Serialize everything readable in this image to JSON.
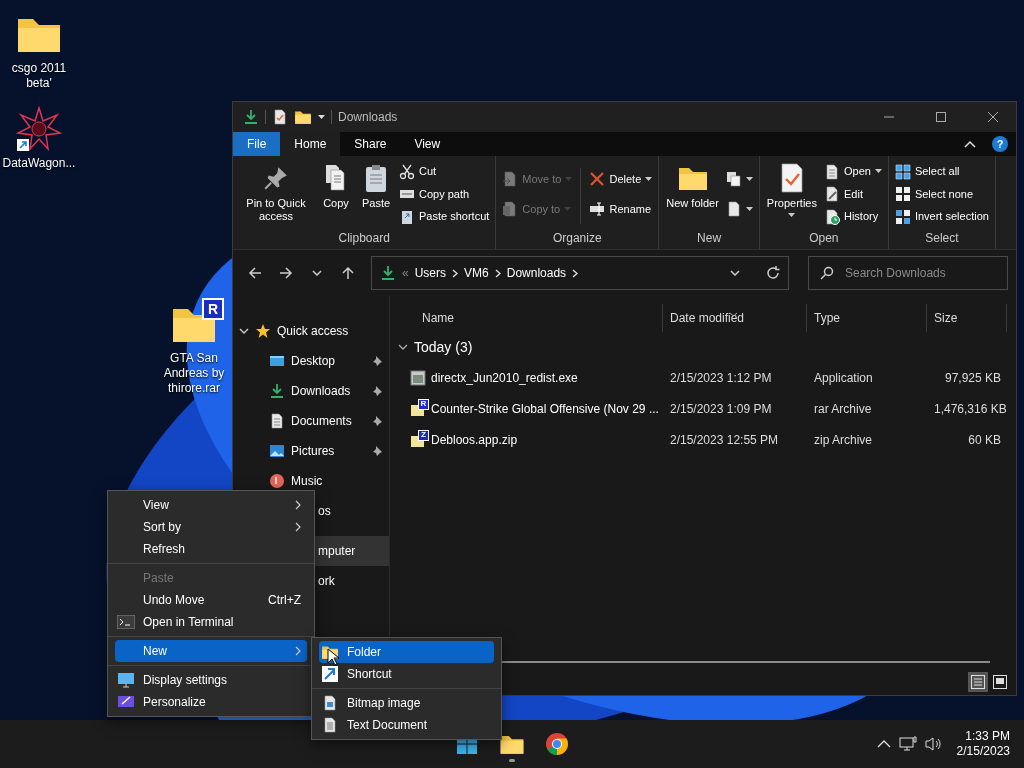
{
  "desktop_icons": [
    {
      "label": "csgo 2011 beta'"
    },
    {
      "label": "DataWagon..."
    },
    {
      "label": "GTA San Andreas by thirore.rar",
      "badge": "R"
    }
  ],
  "explorer": {
    "title": "Downloads",
    "ribbon_tabs": [
      {
        "label": "File",
        "kind": "file",
        "selected": false
      },
      {
        "label": "Home",
        "kind": "tab",
        "selected": true
      },
      {
        "label": "Share",
        "kind": "tab",
        "selected": false
      },
      {
        "label": "View",
        "kind": "tab",
        "selected": false
      }
    ],
    "help_label": "?",
    "ribbon_groups": [
      {
        "label": "Clipboard",
        "columns": [
          {
            "kind": "stack",
            "commands": [
              {
                "label": "Pin to Quick access",
                "kind": "large",
                "dropdown": false,
                "disabled": false
              }
            ]
          },
          {
            "kind": "stack",
            "commands": [
              {
                "label": "Copy",
                "kind": "large",
                "dropdown": false,
                "disabled": false
              }
            ]
          },
          {
            "kind": "stack",
            "commands": [
              {
                "label": "Paste",
                "kind": "large",
                "dropdown": false,
                "disabled": false
              }
            ]
          },
          {
            "kind": "stack",
            "commands": [
              {
                "label": "Cut",
                "kind": "small",
                "dropdown": false,
                "disabled": false
              },
              {
                "label": "Copy path",
                "kind": "small",
                "dropdown": false,
                "disabled": false
              },
              {
                "label": "Paste shortcut",
                "kind": "small",
                "dropdown": false,
                "disabled": false
              }
            ]
          }
        ]
      },
      {
        "label": "Organize",
        "columns": [
          {
            "kind": "stack",
            "commands": [
              {
                "label": "Move to",
                "kind": "small",
                "dropdown": true,
                "disabled": true
              },
              {
                "label": "Copy to",
                "kind": "small",
                "dropdown": true,
                "disabled": true
              }
            ]
          },
          {
            "kind": "separator"
          },
          {
            "kind": "stack",
            "commands": [
              {
                "label": "Delete",
                "kind": "small",
                "dropdown": true,
                "disabled": false
              },
              {
                "label": "Rename",
                "kind": "small",
                "dropdown": false,
                "disabled": false
              }
            ]
          }
        ]
      },
      {
        "label": "New",
        "columns": [
          {
            "kind": "stack",
            "commands": [
              {
                "label": "New folder",
                "kind": "large",
                "dropdown": false,
                "disabled": false
              }
            ]
          },
          {
            "kind": "stack",
            "commands": [
              {
                "kind": "icon",
                "dropdown": true,
                "disabled": false
              },
              {
                "kind": "icon",
                "dropdown": true,
                "disabled": false
              }
            ]
          }
        ]
      },
      {
        "label": "Open",
        "columns": [
          {
            "kind": "stack",
            "commands": [
              {
                "label": "Properties",
                "kind": "large",
                "dropdown": true,
                "disabled": false
              }
            ]
          },
          {
            "kind": "stack",
            "commands": [
              {
                "label": "Open",
                "kind": "small",
                "dropdown": true,
                "disabled": false
              },
              {
                "label": "Edit",
                "kind": "small",
                "dropdown": false,
                "disabled": false
              },
              {
                "label": "History",
                "kind": "small",
                "dropdown": false,
                "disabled": false
              }
            ]
          }
        ]
      },
      {
        "label": "Select",
        "columns": [
          {
            "kind": "stack",
            "commands": [
              {
                "label": "Select all",
                "kind": "small",
                "dropdown": false,
                "disabled": false
              },
              {
                "label": "Select none",
                "kind": "small",
                "dropdown": false,
                "disabled": false
              },
              {
                "label": "Invert selection",
                "kind": "small",
                "dropdown": false,
                "disabled": false
              }
            ]
          }
        ]
      }
    ],
    "address": {
      "overflow": "«",
      "crumbs": [
        "Users",
        "VM6",
        "Downloads"
      ]
    },
    "search": {
      "placeholder": "Search Downloads"
    },
    "sidebar": [
      {
        "label": "Quick access",
        "expanded": true,
        "selected": false,
        "children": [
          {
            "label": "Desktop",
            "pinned": true,
            "selected": false
          },
          {
            "label": "Downloads",
            "pinned": true,
            "selected": false
          },
          {
            "label": "Documents",
            "pinned": true,
            "selected": false
          },
          {
            "label": "Pictures",
            "pinned": true,
            "selected": false
          },
          {
            "label": "Music",
            "pinned": false,
            "selected": false
          },
          {
            "label": "os",
            "pinned": false,
            "selected": false
          }
        ]
      },
      {
        "label": "mputer",
        "selected": true
      },
      {
        "label": "ork",
        "selected": false
      }
    ],
    "columns": [
      {
        "label": "Name",
        "sorted": false
      },
      {
        "label": "Date modified",
        "sorted": true
      },
      {
        "label": "Type",
        "sorted": false
      },
      {
        "label": "Size",
        "sorted": false
      }
    ],
    "group": {
      "label": "Today (3)",
      "expanded": true
    },
    "rows": [
      {
        "name": "directx_Jun2010_redist.exe",
        "date": "2/15/2023 1:12 PM",
        "type": "Application",
        "size": "97,925 KB"
      },
      {
        "name": "Counter-Strike Global Offensive (Nov 29 ...",
        "badge": "R",
        "date": "2/15/2023 1:09 PM",
        "type": "rar Archive",
        "size": "1,476,316 KB"
      },
      {
        "name": "Debloos.app.zip",
        "badge": "Z",
        "date": "2/15/2023 12:55 PM",
        "type": "zip Archive",
        "size": "60 KB"
      }
    ],
    "view_buttons": [
      {
        "selected": true
      },
      {
        "selected": false
      }
    ]
  },
  "context_menu": [
    {
      "label": "View",
      "kind": "item",
      "submenu": true,
      "disabled": false,
      "selected": false
    },
    {
      "label": "Sort by",
      "kind": "item",
      "submenu": true,
      "disabled": false,
      "selected": false
    },
    {
      "label": "Refresh",
      "kind": "item",
      "submenu": false,
      "disabled": false,
      "selected": false
    },
    {
      "kind": "separator"
    },
    {
      "label": "Paste",
      "kind": "item",
      "submenu": false,
      "disabled": true,
      "selected": false
    },
    {
      "label": "Undo Move",
      "kind": "item",
      "shortcut": "Ctrl+Z",
      "submenu": false,
      "disabled": false,
      "selected": false
    },
    {
      "label": "Open in Terminal",
      "kind": "item",
      "submenu": false,
      "disabled": false,
      "selected": false
    },
    {
      "kind": "separator"
    },
    {
      "label": "New",
      "kind": "item",
      "submenu": true,
      "disabled": false,
      "selected": true
    },
    {
      "kind": "separator"
    },
    {
      "label": "Display settings",
      "kind": "item",
      "submenu": false,
      "disabled": false,
      "selected": false
    },
    {
      "label": "Personalize",
      "kind": "item",
      "submenu": false,
      "disabled": false,
      "selected": false
    }
  ],
  "new_submenu": [
    {
      "label": "Folder",
      "kind": "item",
      "selected": true
    },
    {
      "label": "Shortcut",
      "kind": "item",
      "selected": false
    },
    {
      "kind": "separator"
    },
    {
      "label": "Bitmap image",
      "kind": "item",
      "selected": false
    },
    {
      "label": "Text Document",
      "kind": "item",
      "selected": false
    }
  ],
  "taskbar": {
    "apps": [
      {
        "running": false
      },
      {
        "running": true
      },
      {
        "running": false
      }
    ],
    "clock": {
      "time": "1:33 PM",
      "date": "2/15/2023"
    }
  }
}
